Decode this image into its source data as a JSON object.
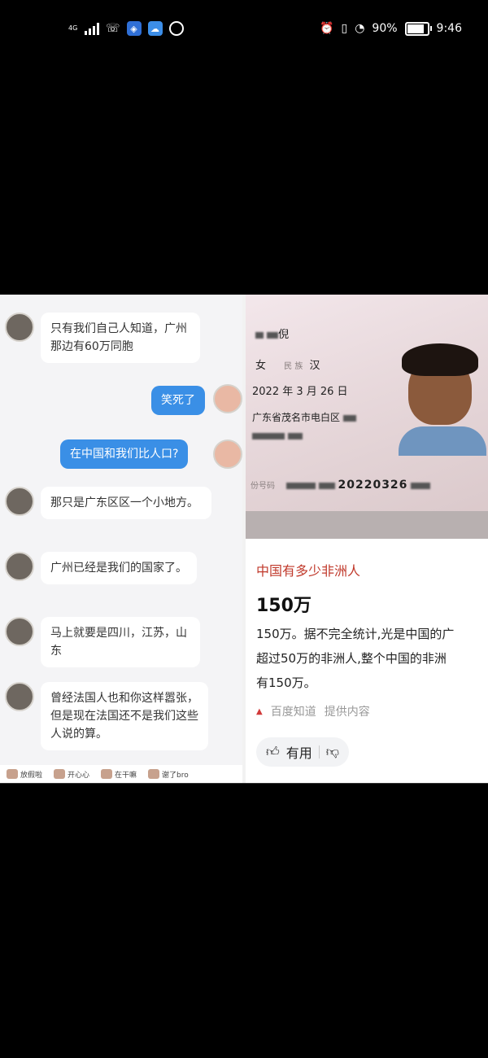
{
  "status_bar": {
    "network": "4G",
    "battery_percent": "90%",
    "time": "9:46",
    "battery_level": 0.9
  },
  "chat": {
    "messages": [
      {
        "side": "left",
        "text": "只有我们自己人知道，广州那边有60万同胞"
      },
      {
        "side": "right",
        "text": "笑死了"
      },
      {
        "side": "right",
        "text": "在中国和我们比人口?"
      },
      {
        "side": "left",
        "text": "那只是广东区区一个小地方。"
      },
      {
        "side": "left",
        "text": "广州已经是我们的国家了。"
      },
      {
        "side": "left",
        "text": "马上就要是四川，江苏，山东"
      },
      {
        "side": "left",
        "text": "曾经法国人也和你这样嚣张，但是现在法国还不是我们这些人说的算。"
      }
    ],
    "emoji_bar": [
      "放假啦",
      "开心心",
      "在干嘛",
      "谢了bro"
    ]
  },
  "id_card": {
    "name_char": "倪",
    "sex_label": "女",
    "ethnicity_label": "民 族",
    "ethnicity": "汉",
    "birth": "2022 年 3 月 26 日",
    "address": "广东省茂名市电白区",
    "id_label": "份号码",
    "id_number_visible": "20220326"
  },
  "answer": {
    "question": "中国有多少非洲人",
    "headline": "150万",
    "body_lines": [
      "150万。据不完全统计,光是中国的广",
      "超过50万的非洲人,整个中国的非洲",
      "有150万。"
    ],
    "source_name": "百度知道",
    "source_suffix": "提供内容",
    "useful_label": "有用"
  }
}
